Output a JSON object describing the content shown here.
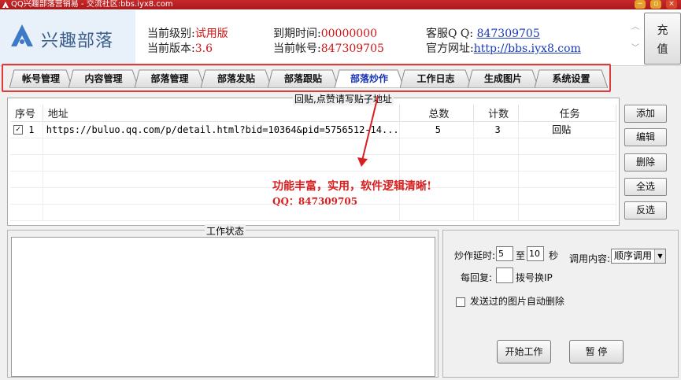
{
  "titlebar": {
    "title": "QQ兴趣部落营销易 - 交流社区:bbs.iyx8.com",
    "minimize_glyph": "−",
    "restore_glyph": "▫",
    "close_glyph": "×"
  },
  "header": {
    "logo_text": "兴趣部落",
    "level_label": "当前级别:",
    "level_value": "试用版",
    "version_label": "当前版本:",
    "version_value": "3.6",
    "expire_label": "到期时间:",
    "expire_value": "00000000",
    "account_label": "当前帐号:",
    "account_value": "847309705",
    "service_label": "客服Q Q: ",
    "service_value": "847309705",
    "site_label": "官方网址:",
    "site_value": "http://bbs.iyx8.com",
    "charge_button": "充\n值",
    "charge_line1": "充",
    "charge_line2": "值"
  },
  "tabs": [
    {
      "label": "帐号管理"
    },
    {
      "label": "内容管理"
    },
    {
      "label": "部落管理"
    },
    {
      "label": "部落发贴"
    },
    {
      "label": "部落跟贴"
    },
    {
      "label": "部落炒作"
    },
    {
      "label": "工作日志"
    },
    {
      "label": "生成图片"
    },
    {
      "label": "系统设置"
    }
  ],
  "active_tab": "部落炒作",
  "list": {
    "caption": "回贴,点赞请写贴子地址",
    "columns": [
      "序号",
      "地址",
      "总数",
      "计数",
      "任务"
    ],
    "rows": [
      {
        "checked": true,
        "index": "1",
        "address": "https://buluo.qq.com/p/detail.html?bid=10364&pid=5756512-14...",
        "total": "5",
        "count": "3",
        "task": "回贴"
      }
    ]
  },
  "side_buttons": {
    "add": "添加",
    "edit": "编辑",
    "delete": "删除",
    "select_all": "全选",
    "invert": "反选"
  },
  "annotation": {
    "line1": "功能丰富，实用，软件逻辑清晰!",
    "line2": "QQ：847309705"
  },
  "status": {
    "caption": "工作状态"
  },
  "settings": {
    "delay_label": "炒作延时:",
    "delay_from": "5",
    "delay_to_label": "至",
    "delay_to": "10",
    "delay_unit": "秒",
    "call_content_label": "调用内容:",
    "call_content_value": "顺序调用",
    "per_reply_label": "每回复:",
    "per_reply_value": "",
    "dial_ip_label": "拨号换IP",
    "auto_delete_label": "发送过的图片自动删除",
    "auto_delete_checked": false,
    "start_button": "开始工作",
    "pause_button": "暂 停"
  },
  "colors": {
    "accent_red": "#d01414",
    "link_blue": "#1a3bb8",
    "active_tab_text": "#1834b5",
    "highlight_border": "#e03a3a"
  }
}
